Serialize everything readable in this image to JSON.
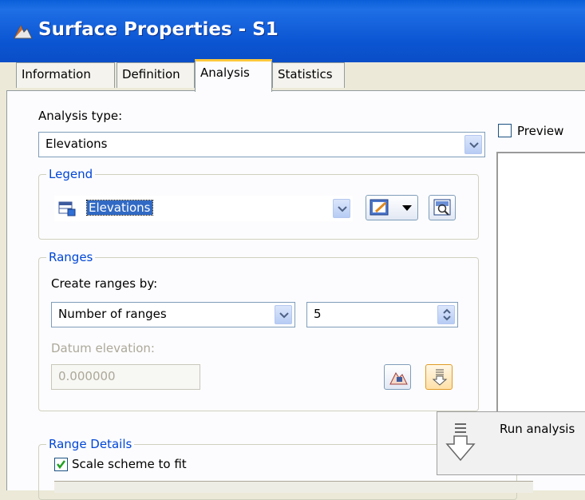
{
  "window": {
    "title": "Surface Properties - S1",
    "app_icon": "autocad-surface-icon"
  },
  "tabs": [
    {
      "label": "Information",
      "active": false
    },
    {
      "label": "Definition",
      "active": false
    },
    {
      "label": "Analysis",
      "active": true
    },
    {
      "label": "Statistics",
      "active": false
    }
  ],
  "analysis": {
    "type_label": "Analysis type:",
    "type_value": "Elevations"
  },
  "preview": {
    "label": "Preview",
    "checked": false
  },
  "legend": {
    "group_label": "Legend",
    "value": "Elevations"
  },
  "ranges": {
    "group_label": "Ranges",
    "create_by_label": "Create ranges by:",
    "create_by_value": "Number of ranges",
    "count_value": "5",
    "datum_label": "Datum elevation:",
    "datum_value": "0.000000"
  },
  "range_details": {
    "group_label": "Range Details",
    "scale_label": "Scale scheme to fit",
    "scale_checked": true
  },
  "run": {
    "label": "Run analysis"
  },
  "colors": {
    "titlebar": "#0b55d2",
    "group_label": "#0046d5",
    "active_tab_accent": "#ffc83c",
    "disabled_text": "#aca899"
  }
}
